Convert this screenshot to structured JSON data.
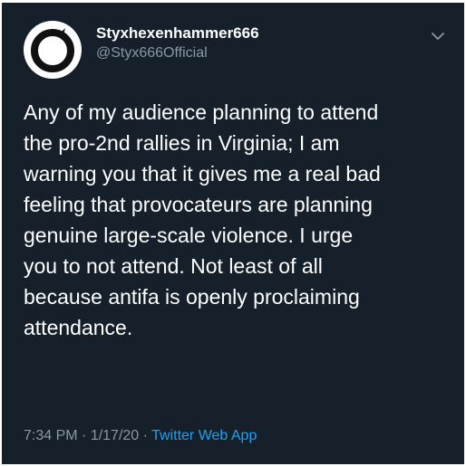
{
  "author": {
    "display_name": "Styxhexenhammer666",
    "handle": "@Styx666Official",
    "avatar_icon": "ouroboros-icon"
  },
  "menu": {
    "icon": "chevron-down-icon"
  },
  "tweet": {
    "lines": [
      "Any of my audience planning to attend",
      "the pro-2nd rallies in Virginia; I am",
      "warning you that it gives me a real bad",
      "feeling that provocateurs are planning",
      "genuine large-scale violence. I urge",
      "you to not attend. Not least of all",
      "because antifa is openly proclaiming",
      "attendance."
    ],
    "time": "7:34 PM",
    "date": "1/17/20",
    "separator_1": " · ",
    "separator_2": " · ",
    "source": "Twitter Web App"
  },
  "colors": {
    "background": "#15202b",
    "text": "#ffffff",
    "secondary": "#8899a6",
    "link": "#1da1f2"
  }
}
